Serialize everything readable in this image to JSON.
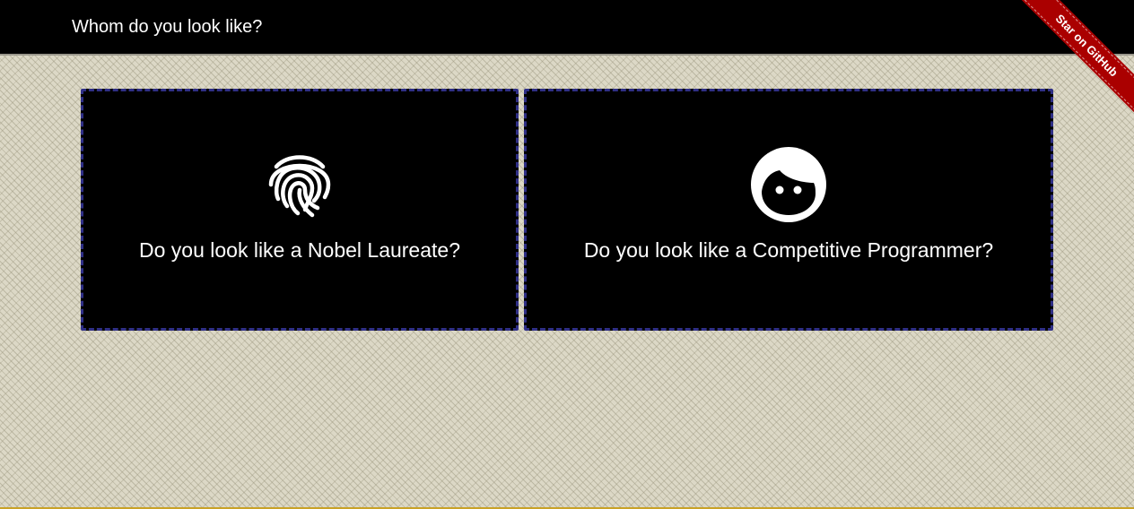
{
  "header": {
    "title": "Whom do you look like?"
  },
  "ribbon": {
    "label": "Star on GitHub"
  },
  "cards": [
    {
      "icon": "fingerprint-icon",
      "label": "Do you look like a Nobel Laureate?"
    },
    {
      "icon": "face-icon",
      "label": "Do you look like a Competitive Programmer?"
    }
  ],
  "colors": {
    "navbar": "#000000",
    "card_background": "#000000",
    "card_border": "#2f2f86",
    "ribbon": "#aa0000",
    "page_background": "#dcd8c6"
  }
}
